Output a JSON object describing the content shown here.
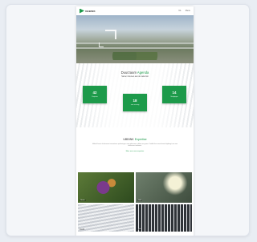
{
  "header": {
    "logo_text": "UBBINK",
    "nav": [
      "NL",
      "Menu"
    ]
  },
  "stats": {
    "title_plain": "Duurzaam",
    "title_accent": "Agenda",
    "subtitle": "Samen bouwen aan de toekomst",
    "items": [
      {
        "value": "42",
        "label": "Projecten"
      },
      {
        "value": "18",
        "label": "Jaar ervaring"
      },
      {
        "value": "14",
        "label": "Vestigingen"
      }
    ]
  },
  "expertise": {
    "title_plain": "UBBINK",
    "title_accent": "Expertise",
    "body": "Ubbink levert al decennia innovatieve oplossingen voor gebouwen, daken en groen. Ontdek hoe onze kennis bijdraagt aan een duurzame toekomst.",
    "link": "Meer over onze expertise"
  },
  "tiles": [
    {
      "caption": "Groen"
    },
    {
      "caption": "Licht"
    },
    {
      "caption": "Dak"
    },
    {
      "caption": "Zon"
    }
  ],
  "colors": {
    "accent": "#1d9a4a"
  }
}
